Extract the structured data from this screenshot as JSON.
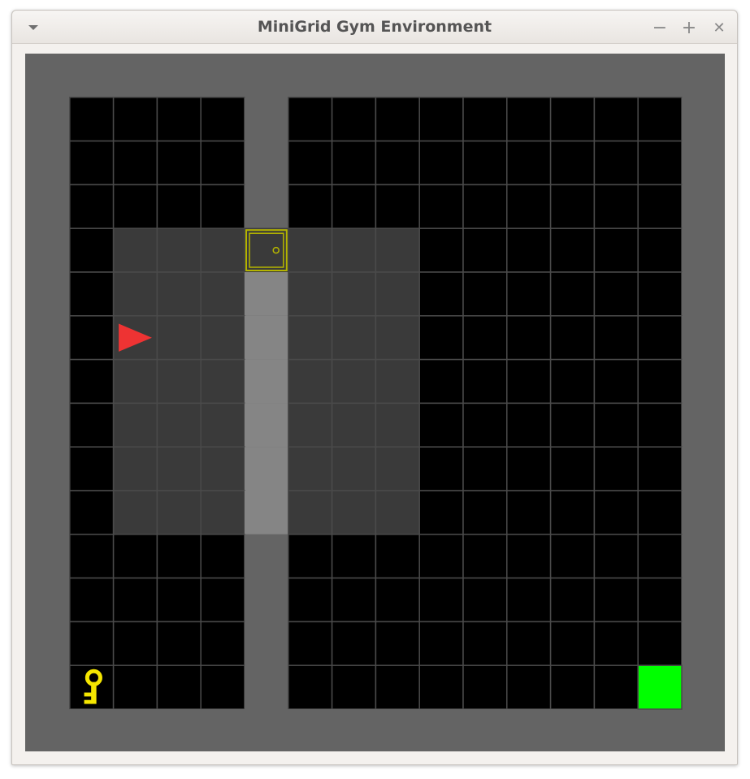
{
  "window": {
    "title": "MiniGrid Gym Environment",
    "buttons": {
      "minimize": "−",
      "maximize": "+",
      "close": "✕"
    }
  },
  "environment": {
    "grid_width": 16,
    "grid_height": 16,
    "wall_column": 5,
    "door": {
      "col": 5,
      "row": 4,
      "color": "#b4b400",
      "state": "closed"
    },
    "agent": {
      "col": 2,
      "row": 6,
      "direction": "right",
      "color": "#ee3333"
    },
    "key": {
      "col": 1,
      "row": 14,
      "color": "#f5e600"
    },
    "goal": {
      "col": 14,
      "row": 14,
      "color": "#00ff00"
    },
    "visible_area": {
      "col_start": 2,
      "col_end": 8,
      "row_start": 3,
      "row_end": 9
    },
    "colors": {
      "wall": "#646464",
      "floor": "#000000",
      "visible_floor": "#3a3a3a",
      "visible_wall": "#858585",
      "grid_line": "#4a4a4a"
    }
  }
}
